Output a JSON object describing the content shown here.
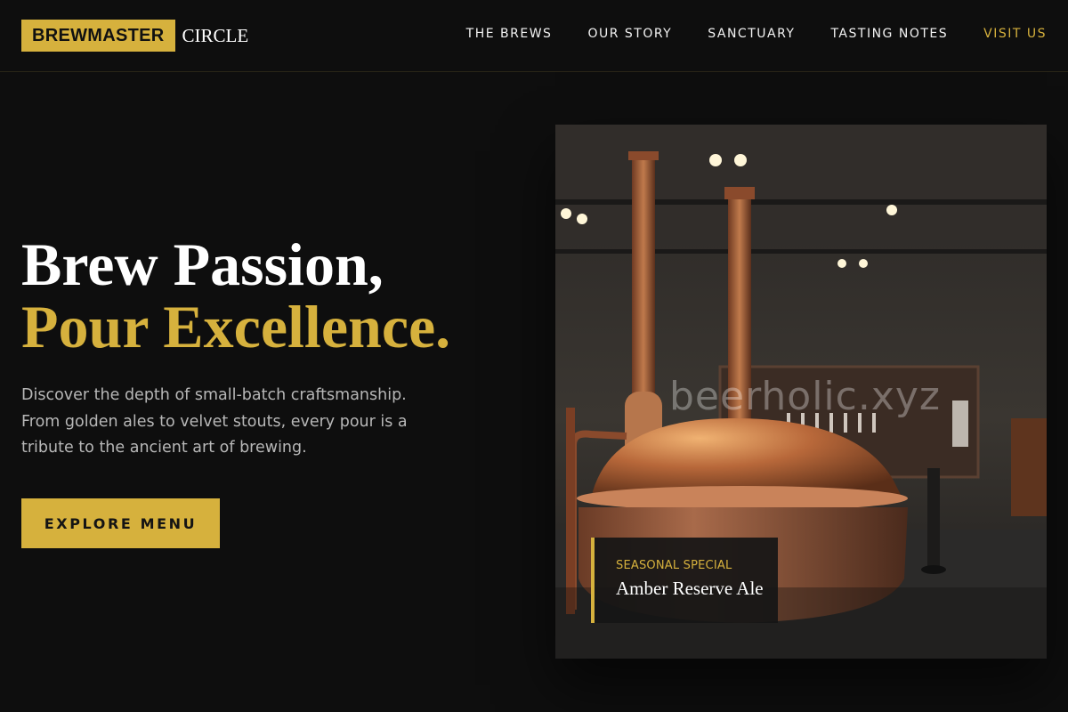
{
  "brand": {
    "primary": "BREWMASTER",
    "secondary": "CIRCLE"
  },
  "nav": [
    {
      "label": "THE BREWS"
    },
    {
      "label": "OUR STORY"
    },
    {
      "label": "SANCTUARY"
    },
    {
      "label": "TASTING NOTES"
    },
    {
      "label": "VISIT US"
    }
  ],
  "hero": {
    "line1": "Brew Passion,",
    "line2": "Pour Excellence.",
    "description": "Discover the depth of small-batch craftsmanship. From golden ales to velvet stouts, every pour is a tribute to the ancient art of brewing.",
    "cta": "EXPLORE MENU"
  },
  "feature": {
    "watermark": "beerholic.xyz",
    "tag": "SEASONAL SPECIAL",
    "name": "Amber Reserve Ale"
  },
  "colors": {
    "accent": "#d6b13d",
    "background": "#0e0e0e"
  }
}
